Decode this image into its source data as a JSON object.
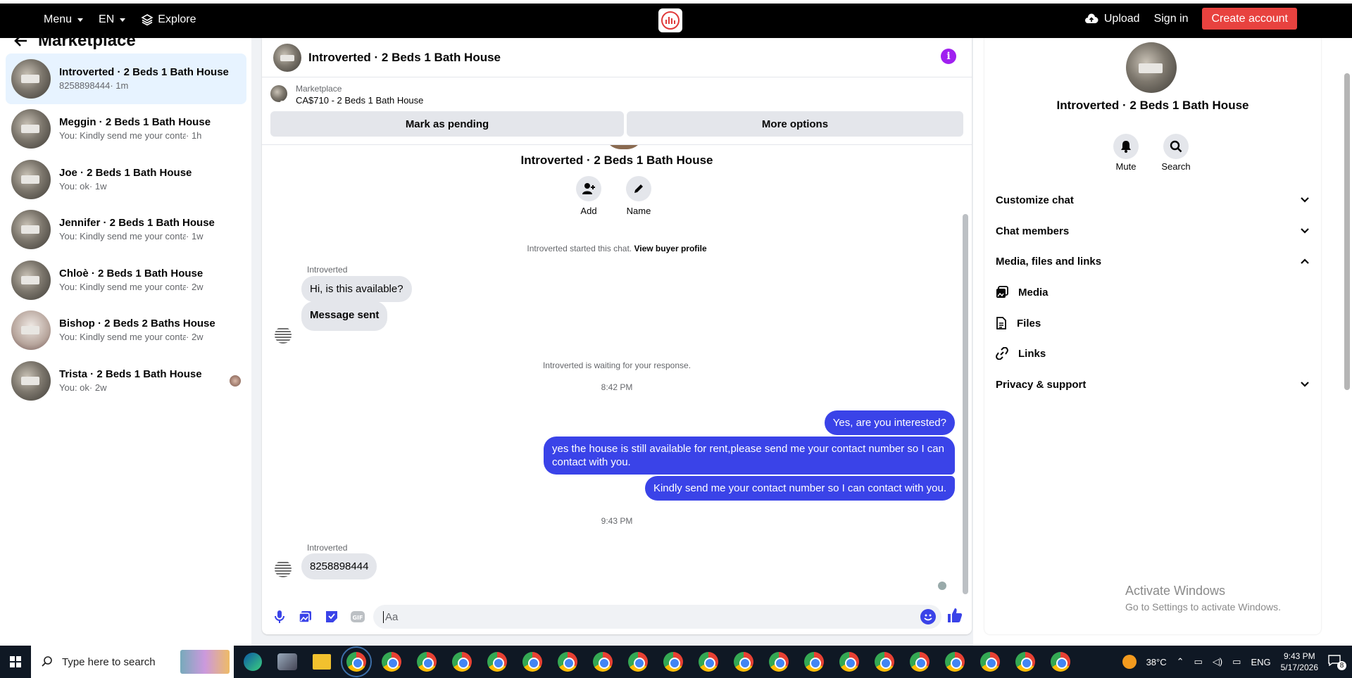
{
  "topbar": {
    "menu": "Menu",
    "lang": "EN",
    "explore": "Explore",
    "upload": "Upload",
    "signin": "Sign in",
    "create": "Create account"
  },
  "sidebar": {
    "title": "Marketplace",
    "items": [
      {
        "name": "Introverted · 2 Beds 1 Bath House",
        "preview": "8258898444",
        "time": "· 1m"
      },
      {
        "name": "Meggin · 2 Beds 1 Bath House",
        "preview": "You: Kindly send me your contact nu...",
        "time": "· 1h"
      },
      {
        "name": "Joe · 2 Beds 1 Bath House",
        "preview": "You: ok",
        "time": "· 1w"
      },
      {
        "name": "Jennifer · 2 Beds 1 Bath House",
        "preview": "You: Kindly send me your contact nu...",
        "time": "· 1w"
      },
      {
        "name": "Chloè · 2 Beds 1 Bath House",
        "preview": "You: Kindly send me your contact nu...",
        "time": "· 2w"
      },
      {
        "name": "Bishop · 2 Beds 2 Baths House",
        "preview": "You: Kindly send me your contact nu...",
        "time": "· 2w"
      },
      {
        "name": "Trista · 2 Beds 1 Bath House",
        "preview": "You: ok",
        "time": "· 2w"
      }
    ]
  },
  "chat": {
    "title": "Introverted · 2 Beds 1 Bath House",
    "listing_label": "Marketplace",
    "listing_price": "CA$710 - 2 Beds 1 Bath House",
    "mark_pending": "Mark as pending",
    "more_options": "More options",
    "header_name": "Introverted · 2 Beds 1 Bath House",
    "add_label": "Add",
    "name_label": "Name",
    "started": "Introverted started this chat.",
    "view_profile": "View buyer profile",
    "sender": "Introverted",
    "msg1": "Hi, is this available?",
    "msg2": "Message sent",
    "waiting": "Introverted is waiting for your response.",
    "time1": "8:42 PM",
    "out1": "Yes, are you interested?",
    "out2": "yes the house is still available for rent,please send me your contact number so I can contact with you.",
    "out3": "Kindly send me your contact number so I can contact with you.",
    "time2": "9:43 PM",
    "sender2": "Introverted",
    "msg3": "8258898444",
    "placeholder": "Aa"
  },
  "details": {
    "name": "Introverted · 2 Beds 1 Bath House",
    "mute": "Mute",
    "search": "Search",
    "customize": "Customize chat",
    "members": "Chat members",
    "media_files": "Media, files and links",
    "media": "Media",
    "files": "Files",
    "links": "Links",
    "privacy": "Privacy & support"
  },
  "watermark": {
    "line1": "Activate Windows",
    "line2": "Go to Settings to activate Windows."
  },
  "taskbar": {
    "search": "Type here to search",
    "temp": "38°C",
    "lang": "ENG",
    "time": "9:43 PM",
    "date": "5/17/2026",
    "notif": "8"
  },
  "colors": {
    "accent": "#3a43e8",
    "brand": "#e8423f",
    "info": "#a020f0"
  }
}
